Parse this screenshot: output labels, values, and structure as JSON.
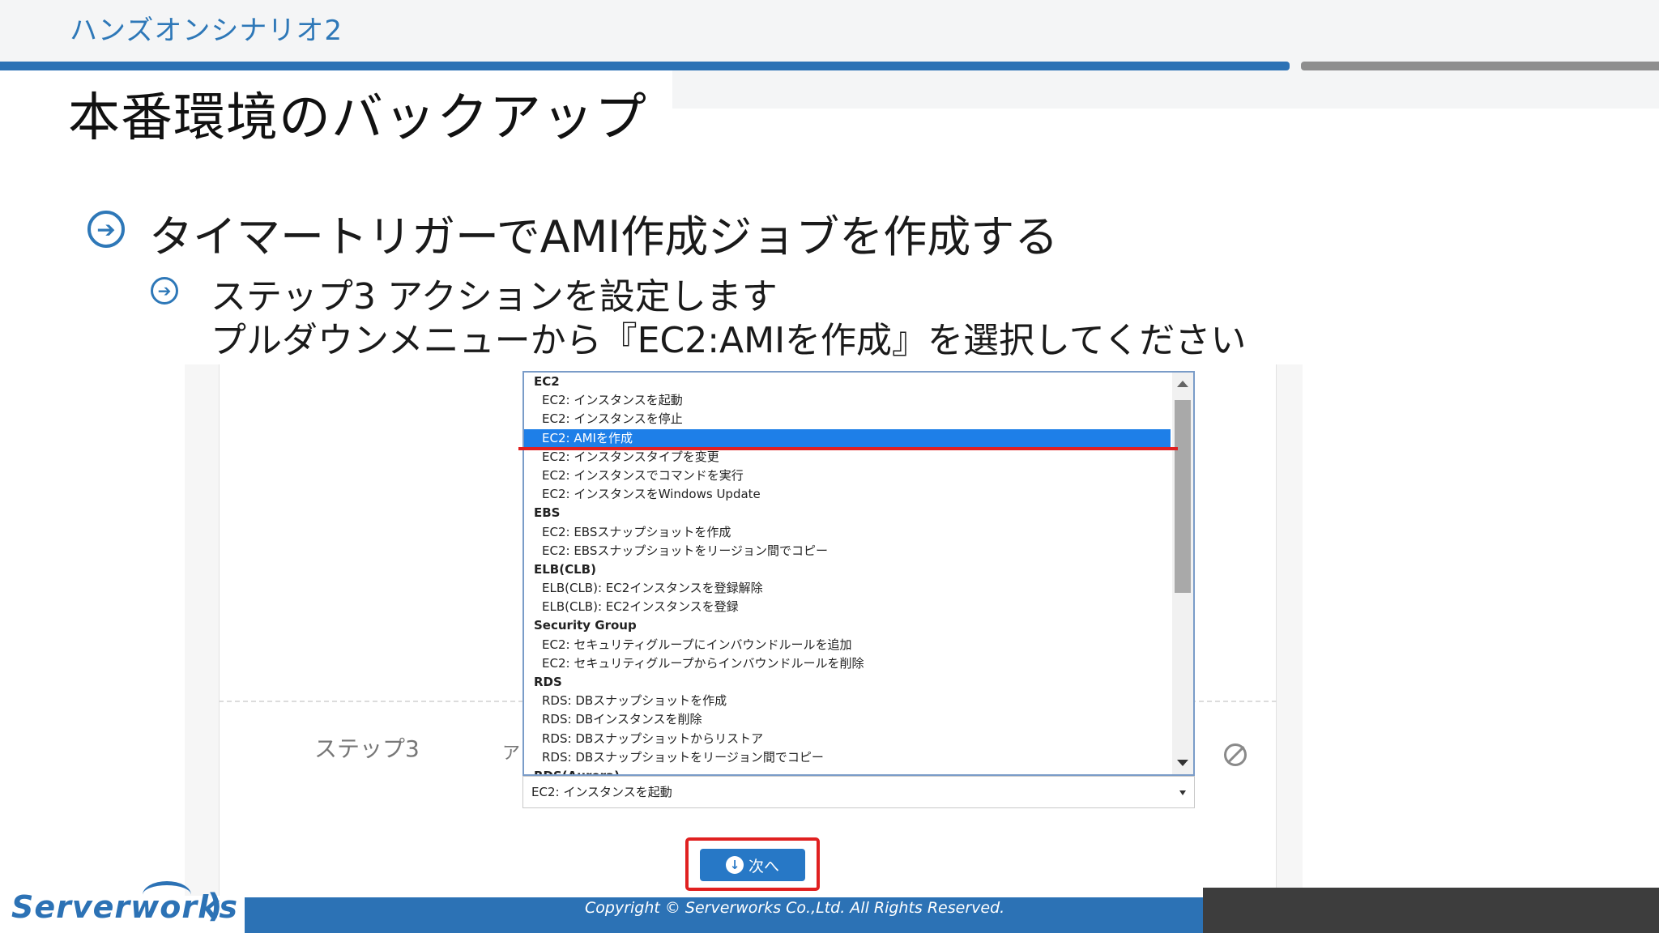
{
  "header": {
    "section_label": "ハンズオンシナリオ2",
    "title": "本番環境のバックアップ"
  },
  "bullets": {
    "main": "タイマートリガーでAMI作成ジョブを作成する",
    "sub_line1": "ステップ3 アクションを設定します",
    "sub_line2": "プルダウンメニューから『EC2:AMIを作成』を選択してください"
  },
  "screenshot": {
    "step_label": "ステップ3",
    "action_label": "ア",
    "dropdown_options": [
      {
        "label": "EC2",
        "type": "group"
      },
      {
        "label": "EC2: インスタンスを起動",
        "type": "option"
      },
      {
        "label": "EC2: インスタンスを停止",
        "type": "option"
      },
      {
        "label": "EC2: AMIを作成",
        "type": "option",
        "selected": true
      },
      {
        "label": "EC2: インスタンスタイプを変更",
        "type": "option"
      },
      {
        "label": "EC2: インスタンスでコマンドを実行",
        "type": "option"
      },
      {
        "label": "EC2: インスタンスをWindows Update",
        "type": "option"
      },
      {
        "label": "EBS",
        "type": "group"
      },
      {
        "label": "EC2: EBSスナップショットを作成",
        "type": "option"
      },
      {
        "label": "EC2: EBSスナップショットをリージョン間でコピー",
        "type": "option"
      },
      {
        "label": "ELB(CLB)",
        "type": "group"
      },
      {
        "label": "ELB(CLB): EC2インスタンスを登録解除",
        "type": "option"
      },
      {
        "label": "ELB(CLB): EC2インスタンスを登録",
        "type": "option"
      },
      {
        "label": "Security Group",
        "type": "group"
      },
      {
        "label": "EC2: セキュリティグループにインバウンドルールを追加",
        "type": "option"
      },
      {
        "label": "EC2: セキュリティグループからインバウンドルールを削除",
        "type": "option"
      },
      {
        "label": "RDS",
        "type": "group"
      },
      {
        "label": "RDS: DBスナップショットを作成",
        "type": "option"
      },
      {
        "label": "RDS: DBインスタンスを削除",
        "type": "option"
      },
      {
        "label": "RDS: DBスナップショットからリストア",
        "type": "option"
      },
      {
        "label": "RDS: DBスナップショットをリージョン間でコピー",
        "type": "option"
      },
      {
        "label": "RDS(Aurora)",
        "type": "group"
      }
    ],
    "select_value": "EC2: インスタンスを起動",
    "next_button_label": "次へ"
  },
  "footer": {
    "copyright": "Copyright ©  Serverworks Co.,Ltd. All Rights Reserved.",
    "logo_text": "Serverworks"
  },
  "colors": {
    "accent_blue": "#2c72b5",
    "highlight_red": "#e02020",
    "selected_option": "#1e7fe8"
  }
}
